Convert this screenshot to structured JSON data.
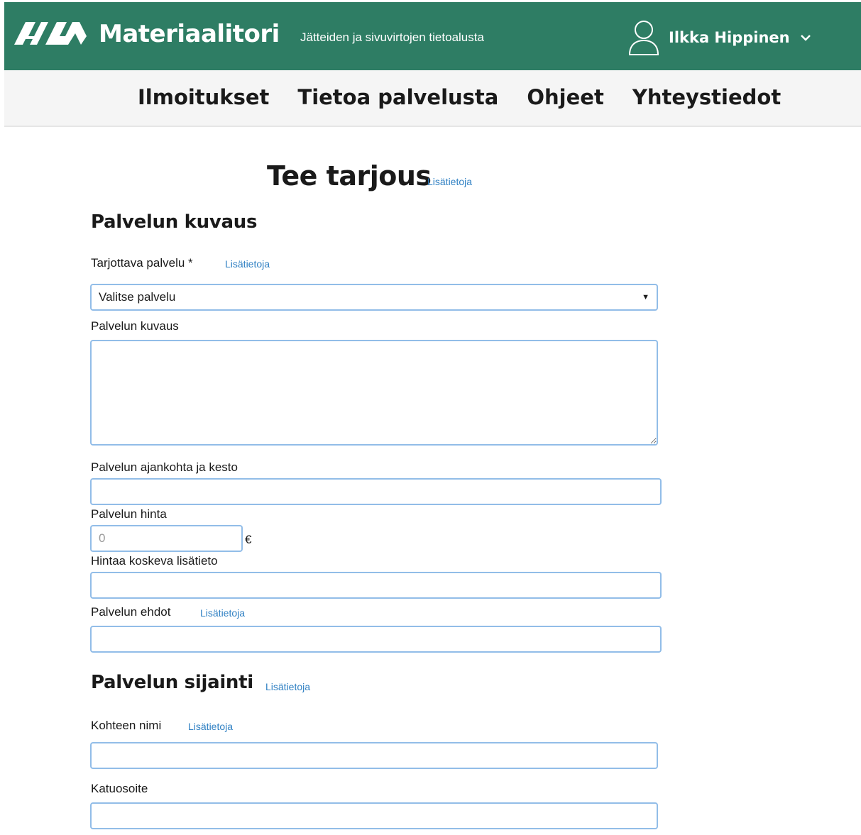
{
  "header": {
    "brand": "Materiaalitori",
    "tagline": "Jätteiden ja sivuvirtojen tietoalusta",
    "user_name": "Ilkka Hippinen"
  },
  "nav": {
    "items": [
      "Ilmoitukset",
      "Tietoa palvelusta",
      "Ohjeet",
      "Yhteystiedot"
    ]
  },
  "page": {
    "title": "Tee tarjous",
    "info_link": "Lisätietoja"
  },
  "service_description": {
    "heading": "Palvelun kuvaus",
    "offered_service_label": "Tarjottava palvelu *",
    "offered_service_info": "Lisätietoja",
    "offered_service_selected": "Valitse palvelu",
    "description_label": "Palvelun kuvaus",
    "timing_label": "Palvelun ajankohta ja kesto",
    "price_label": "Palvelun hinta",
    "price_placeholder": "0",
    "currency": "€",
    "price_info_label": "Hintaa koskeva lisätieto",
    "terms_label": "Palvelun ehdot",
    "terms_info": "Lisätietoja"
  },
  "service_location": {
    "heading": "Palvelun sijainti",
    "heading_info": "Lisätietoja",
    "site_name_label": "Kohteen nimi",
    "site_name_info": "Lisätietoja",
    "street_address_label": "Katuosoite"
  },
  "colors": {
    "header_bg": "#2e7d64",
    "nav_bg": "#f5f5f5",
    "link": "#2f80c3",
    "field_border": "#92bde8"
  }
}
